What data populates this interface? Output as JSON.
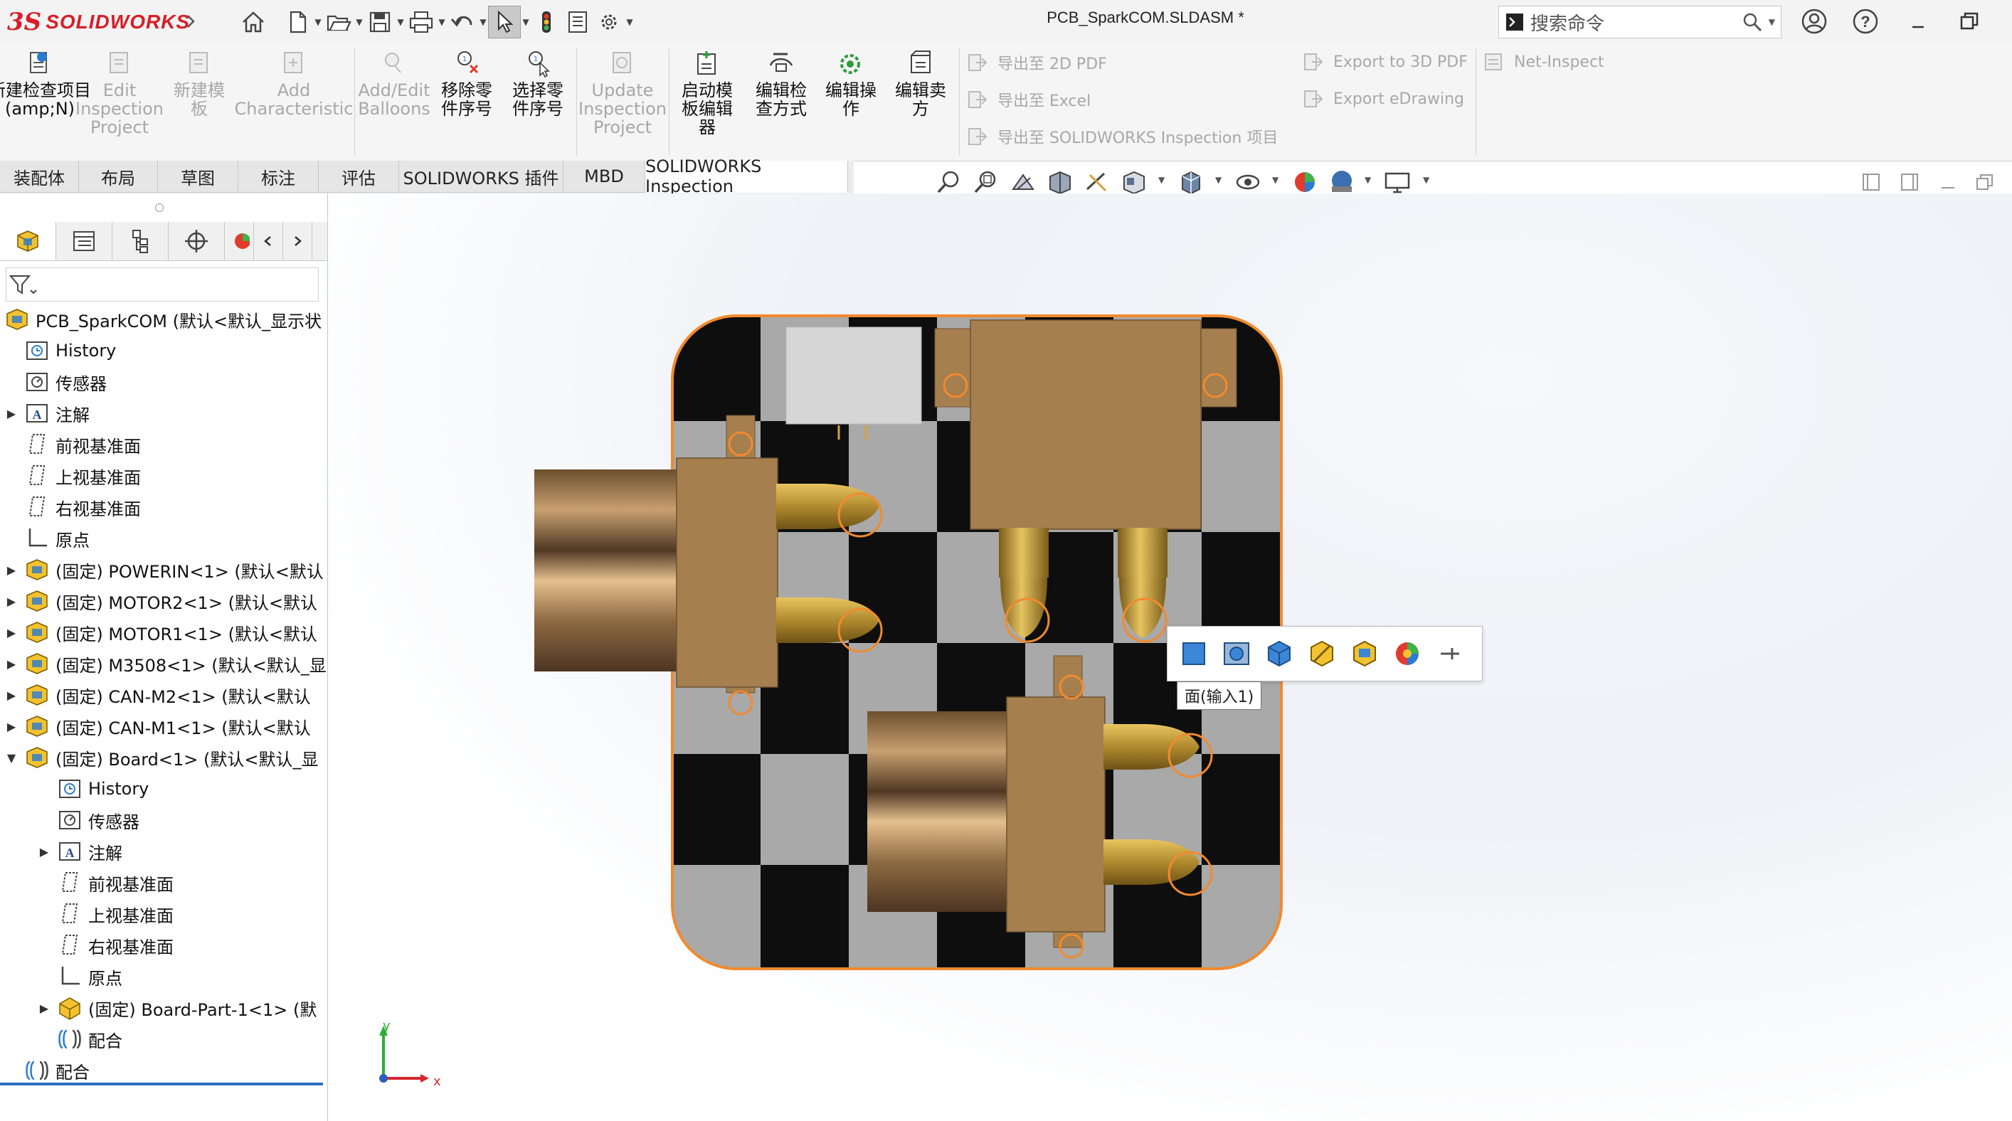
{
  "titlebar": {
    "brand": "SOLIDWORKS",
    "document_title": "PCB_SparkCOM.SLDASM *",
    "search_placeholder": "搜索命令",
    "icons": [
      "home-icon",
      "new-icon",
      "open-icon",
      "save-icon",
      "print-icon",
      "undo-icon",
      "select-icon",
      "rebuild-icon",
      "file-properties-icon",
      "options-icon",
      "user-icon",
      "help-icon",
      "minimize-icon",
      "restore-icon"
    ]
  },
  "command_manager": {
    "buttons": [
      {
        "label": "新建检查项目\n(amp;N)",
        "enabled": true,
        "icon": "new-inspection-icon"
      },
      {
        "label": "Edit\nInspection\nProject",
        "enabled": false,
        "icon": "edit-inspection-icon"
      },
      {
        "label": "新建模\n板",
        "enabled": false,
        "icon": "new-template-icon"
      },
      {
        "label": "Add\nCharacteristic",
        "enabled": false,
        "icon": "add-characteristic-icon"
      },
      {
        "label": "Add/Edit\nBalloons",
        "enabled": false,
        "icon": "balloons-icon"
      },
      {
        "label": "移除零\n件序号",
        "enabled": true,
        "icon": "remove-balloon-icon"
      },
      {
        "label": "选择零\n件序号",
        "enabled": true,
        "icon": "select-balloon-icon"
      },
      {
        "label": "Update\nInspection\nProject",
        "enabled": false,
        "icon": "update-inspection-icon"
      },
      {
        "label": "启动模\n板编辑\n器",
        "enabled": true,
        "icon": "template-editor-icon"
      },
      {
        "label": "编辑检\n查方式",
        "enabled": true,
        "icon": "edit-method-icon"
      },
      {
        "label": "编辑操\n作",
        "enabled": true,
        "icon": "edit-operation-icon"
      },
      {
        "label": "编辑卖\n方",
        "enabled": true,
        "icon": "edit-vendor-icon"
      }
    ],
    "export_col1": [
      "导出至 2D PDF",
      "导出至 Excel",
      "导出至 SOLIDWORKS Inspection 项目"
    ],
    "export_col2": [
      "Export to 3D PDF",
      "Export eDrawing"
    ],
    "net_inspect": "Net-Inspect"
  },
  "tabs": [
    {
      "label": "装配体",
      "active": false
    },
    {
      "label": "布局",
      "active": false
    },
    {
      "label": "草图",
      "active": false
    },
    {
      "label": "标注",
      "active": false
    },
    {
      "label": "评估",
      "active": false
    },
    {
      "label": "SOLIDWORKS 插件",
      "active": false
    },
    {
      "label": "MBD",
      "active": false
    },
    {
      "label": "SOLIDWORKS Inspection",
      "active": true
    }
  ],
  "feature_tree": {
    "root": "PCB_SparkCOM  (默认<默认_显示状",
    "items": [
      {
        "label": "History",
        "icon": "history-icon",
        "indent": 1,
        "expand": ""
      },
      {
        "label": "传感器",
        "icon": "sensor-icon",
        "indent": 1,
        "expand": ""
      },
      {
        "label": "注解",
        "icon": "annotation-icon",
        "indent": 1,
        "expand": "▶"
      },
      {
        "label": "前视基准面",
        "icon": "plane-icon",
        "indent": 1,
        "expand": ""
      },
      {
        "label": "上视基准面",
        "icon": "plane-icon",
        "indent": 1,
        "expand": ""
      },
      {
        "label": "右视基准面",
        "icon": "plane-icon",
        "indent": 1,
        "expand": ""
      },
      {
        "label": "原点",
        "icon": "origin-icon",
        "indent": 1,
        "expand": ""
      },
      {
        "label": "(固定) POWERIN<1> (默认<默认",
        "icon": "assembly-icon",
        "indent": 1,
        "expand": "▶"
      },
      {
        "label": "(固定) MOTOR2<1> (默认<默认",
        "icon": "assembly-icon",
        "indent": 1,
        "expand": "▶"
      },
      {
        "label": "(固定) MOTOR1<1> (默认<默认",
        "icon": "assembly-icon",
        "indent": 1,
        "expand": "▶"
      },
      {
        "label": "(固定) M3508<1> (默认<默认_显",
        "icon": "assembly-icon",
        "indent": 1,
        "expand": "▶"
      },
      {
        "label": "(固定) CAN-M2<1> (默认<默认",
        "icon": "assembly-icon",
        "indent": 1,
        "expand": "▶"
      },
      {
        "label": "(固定) CAN-M1<1> (默认<默认",
        "icon": "assembly-icon",
        "indent": 1,
        "expand": "▶"
      },
      {
        "label": "(固定) Board<1> (默认<默认_显",
        "icon": "assembly-icon",
        "indent": 1,
        "expand": "▼"
      },
      {
        "label": "History",
        "icon": "history-icon",
        "indent": 2,
        "expand": ""
      },
      {
        "label": "传感器",
        "icon": "sensor-icon",
        "indent": 2,
        "expand": ""
      },
      {
        "label": "注解",
        "icon": "annotation-icon",
        "indent": 2,
        "expand": "▶"
      },
      {
        "label": "前视基准面",
        "icon": "plane-icon",
        "indent": 2,
        "expand": ""
      },
      {
        "label": "上视基准面",
        "icon": "plane-icon",
        "indent": 2,
        "expand": ""
      },
      {
        "label": "右视基准面",
        "icon": "plane-icon",
        "indent": 2,
        "expand": ""
      },
      {
        "label": "原点",
        "icon": "origin-icon",
        "indent": 2,
        "expand": ""
      },
      {
        "label": "(固定) Board-Part-1<1> (默",
        "icon": "part-icon",
        "indent": 2,
        "expand": "▶"
      },
      {
        "label": "配合",
        "icon": "mates-icon",
        "indent": 2,
        "expand": ""
      },
      {
        "label": "配合",
        "icon": "mates-icon",
        "indent": 1,
        "expand": ""
      }
    ]
  },
  "viewport": {
    "context_toolbar_icons": [
      "face-icon",
      "sketch-plane-icon",
      "part-icon",
      "hide-component-icon",
      "isolate-icon",
      "appearance-icon",
      "pin-icon"
    ],
    "tooltip": "面(输入1)",
    "triad": {
      "x": "x",
      "y": "y"
    }
  },
  "colors": {
    "brand": "#d71e28",
    "selection": "#f28a2e",
    "connector_brass": "#c29a3a",
    "body_bronze": "#a57f4e"
  }
}
